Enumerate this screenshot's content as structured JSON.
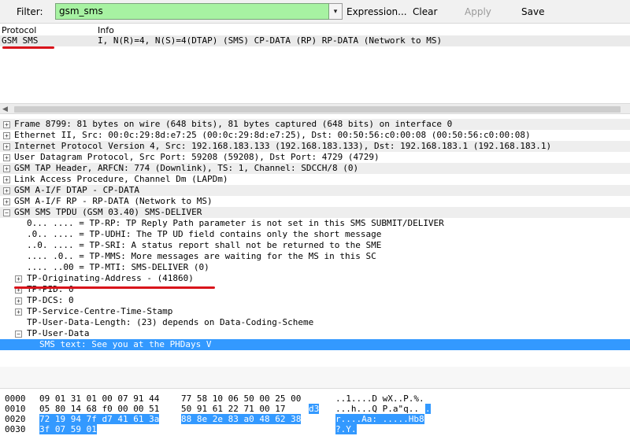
{
  "toolbar": {
    "filter_label": "Filter:",
    "filter_value": "gsm_sms",
    "dropdown_glyph": "▾",
    "expression_label": "Expression...",
    "clear_label": "Clear",
    "apply_label": "Apply",
    "save_label": "Save"
  },
  "packet_list": {
    "columns": {
      "protocol": "Protocol",
      "info": "Info"
    },
    "row": {
      "protocol": "GSM SMS",
      "info": "I, N(R)=4, N(S)=4(DTAP) (SMS) CP-DATA (RP) RP-DATA (Network to MS)"
    }
  },
  "details": {
    "top_level": [
      "Frame 8799: 81 bytes on wire (648 bits), 81 bytes captured (648 bits) on interface 0",
      "Ethernet II, Src: 00:0c:29:8d:e7:25 (00:0c:29:8d:e7:25), Dst: 00:50:56:c0:00:08 (00:50:56:c0:00:08)",
      "Internet Protocol Version 4, Src: 192.168.183.133 (192.168.183.133), Dst: 192.168.183.1 (192.168.183.1)",
      "User Datagram Protocol, Src Port: 59208 (59208), Dst Port: 4729 (4729)",
      "GSM TAP Header, ARFCN: 774 (Downlink), TS: 1, Channel: SDCCH/8 (0)",
      "Link Access Procedure, Channel Dm (LAPDm)",
      "GSM A-I/F DTAP - CP-DATA",
      "GSM A-I/F RP - RP-DATA (Network to MS)",
      "GSM SMS TPDU (GSM 03.40) SMS-DELIVER"
    ],
    "tpdu_bits": [
      "0... .... = TP-RP: TP Reply Path parameter is not set in this SMS SUBMIT/DELIVER",
      ".0.. .... = TP-UDHI: The TP UD field contains only the short message",
      "..0. .... = TP-SRI: A status report shall not be returned to the SME",
      ".... .0.. = TP-MMS: More messages are waiting for the MS in this SC",
      ".... ..00 = TP-MTI: SMS-DELIVER (0)"
    ],
    "tpdu_fields": [
      "TP-Originating-Address - (41860)",
      "TP-PID: 0",
      "TP-DCS: 0",
      "TP-Service-Centre-Time-Stamp",
      "TP-User-Data-Length: (23) depends on Data-Coding-Scheme",
      "TP-User-Data"
    ],
    "sms_text": "SMS text: See you at the PHDays V"
  },
  "bytes": {
    "rows": [
      {
        "offset": "0000",
        "hex_a": "09 01 31 01 00 07 91 44",
        "hex_b": "77 58 10 06 50 00 25 00",
        "hex_b_hl": "",
        "ascii_a": "..1....D wX..P.%.",
        "ascii_b": ""
      },
      {
        "offset": "0010",
        "hex_a": "05 80 14 68 f0 00 00 51",
        "hex_b": "50 91 61 22 71 00 17",
        "hex_b_hl": "d3",
        "ascii_a": "...h...Q P.a\"q..",
        "ascii_b": "."
      },
      {
        "offset": "0020",
        "hex_a": "72 19 94 7f d7 41 61 3a",
        "hex_b": "88 8e 2e 83 a0 48 62 38",
        "hex_b_hl": "",
        "ascii_a": "",
        "ascii_b": "r....Aa: .....Hb8"
      },
      {
        "offset": "0030",
        "hex_a": "3f 07 59 01",
        "hex_b": "",
        "hex_b_hl": "",
        "ascii_a": "",
        "ascii_b": "?.Y."
      }
    ]
  },
  "colors": {
    "filter_bg": "#a7f2a2",
    "selection": "#3399ff",
    "annotation_red": "#d9141b"
  }
}
